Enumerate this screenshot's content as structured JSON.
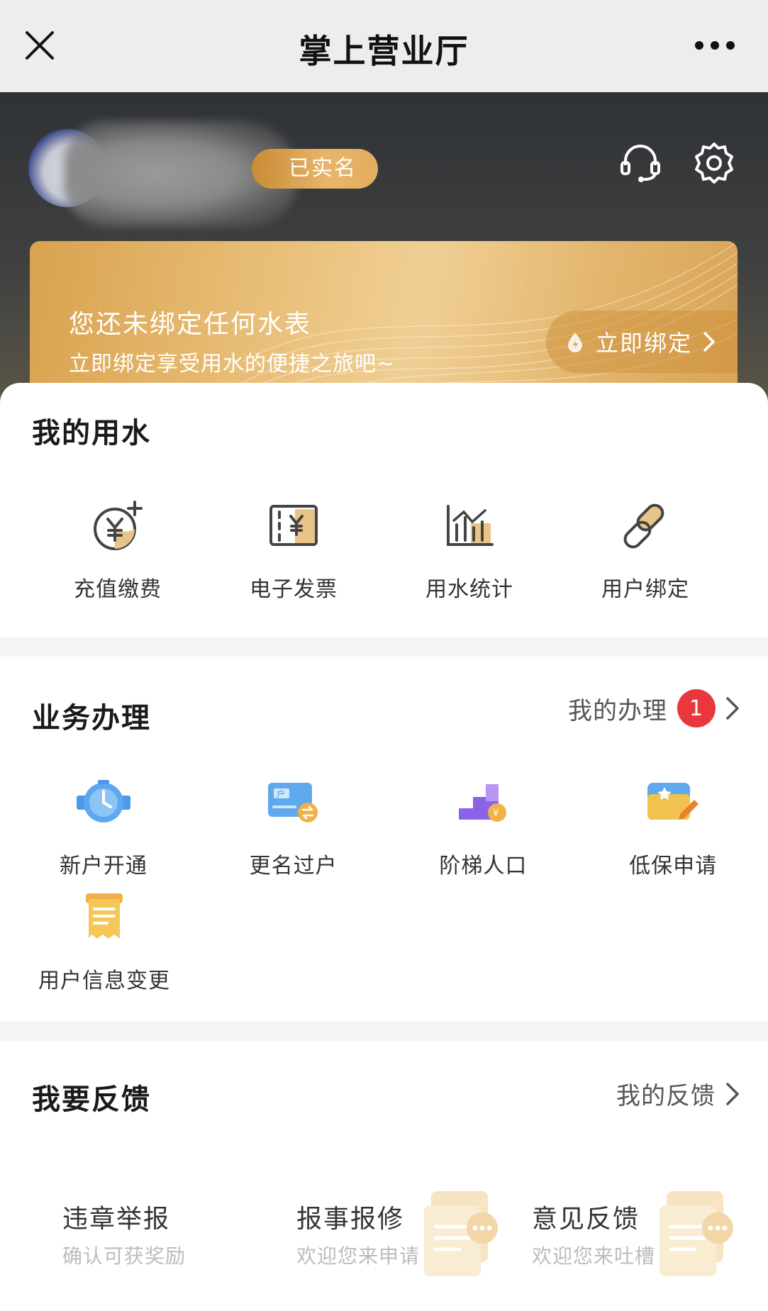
{
  "titlebar": {
    "title": "掌上营业厅"
  },
  "header": {
    "verified_label": "已实名",
    "banner": {
      "title": "您还未绑定任何水表",
      "subtitle": "立即绑定享受用水的便捷之旅吧~",
      "button_label": "立即绑定"
    }
  },
  "my_water": {
    "title": "我的用水",
    "items": [
      {
        "label": "充值缴费",
        "icon": "recharge-icon"
      },
      {
        "label": "电子发票",
        "icon": "invoice-icon"
      },
      {
        "label": "用水统计",
        "icon": "statistics-icon"
      },
      {
        "label": "用户绑定",
        "icon": "link-icon"
      }
    ]
  },
  "business": {
    "title": "业务办理",
    "my_handling_label": "我的办理",
    "my_handling_count": "1",
    "items": [
      {
        "label": "新户开通",
        "icon": "water-meter-icon"
      },
      {
        "label": "更名过户",
        "icon": "transfer-card-icon"
      },
      {
        "label": "阶梯人口",
        "icon": "tier-steps-icon"
      },
      {
        "label": "低保申请",
        "icon": "subsidy-folder-icon"
      },
      {
        "label": "用户信息变更",
        "icon": "document-icon"
      }
    ]
  },
  "feedback": {
    "title": "我要反馈",
    "my_feedback_label": "我的反馈",
    "items": [
      {
        "title": "违章举报",
        "subtitle": "确认可获奖励"
      },
      {
        "title": "报事报修",
        "subtitle": "欢迎您来申请"
      },
      {
        "title": "意见反馈",
        "subtitle": "欢迎您来吐槽"
      }
    ]
  },
  "colors": {
    "accent_gold": "#e2b46c",
    "badge_red": "#e8383d",
    "header_dark": "#2f3236"
  }
}
